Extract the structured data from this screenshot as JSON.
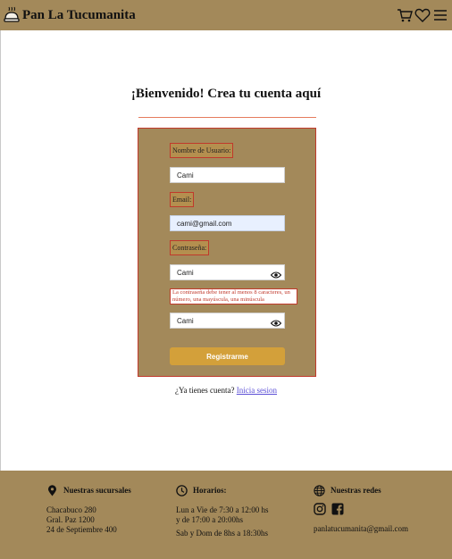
{
  "header": {
    "brand": "Pan La Tucumanita",
    "icons": [
      "bread-logo-icon",
      "cart-icon",
      "heart-icon",
      "menu-icon"
    ]
  },
  "main": {
    "title": "¡Bienvenido! Crea tu cuenta aquí",
    "form": {
      "username_label": "Nombre de Usuario:",
      "username_value": "Cami",
      "email_label": "Email:",
      "email_value": "cami@gmail.com",
      "password_label": "Contraseña:",
      "password_value": "Cami",
      "password_error": "La contraseña debe tener al menos 8 caracteres, un número, una mayúscula, una minúscula",
      "confirm_value": "Cami",
      "submit_label": "Registrarme"
    },
    "login_prompt": "¿Ya tienes cuenta?",
    "login_link": "Inicia sesion"
  },
  "footer": {
    "branches": {
      "title": "Nuestras sucursales",
      "lines": [
        "Chacabuco 280",
        "Gral. Paz 1200",
        "24 de Septiembre 400"
      ]
    },
    "hours": {
      "title": "Horarios:",
      "weekday_line1": "Lun a Vie de 7:30 a 12:00 hs",
      "weekday_line2": "y de 17:00 a 20:00hs",
      "weekend": "Sab y Dom de 8hs a 18:30hs"
    },
    "social": {
      "title": "Nuestras redes",
      "icons": [
        "instagram-icon",
        "facebook-icon"
      ],
      "email": "panlatucumanita@gmail.com"
    }
  },
  "colors": {
    "brand": "#a3895a",
    "button": "#d3a03a",
    "error": "#c0392b",
    "link": "#5b4fd6"
  }
}
